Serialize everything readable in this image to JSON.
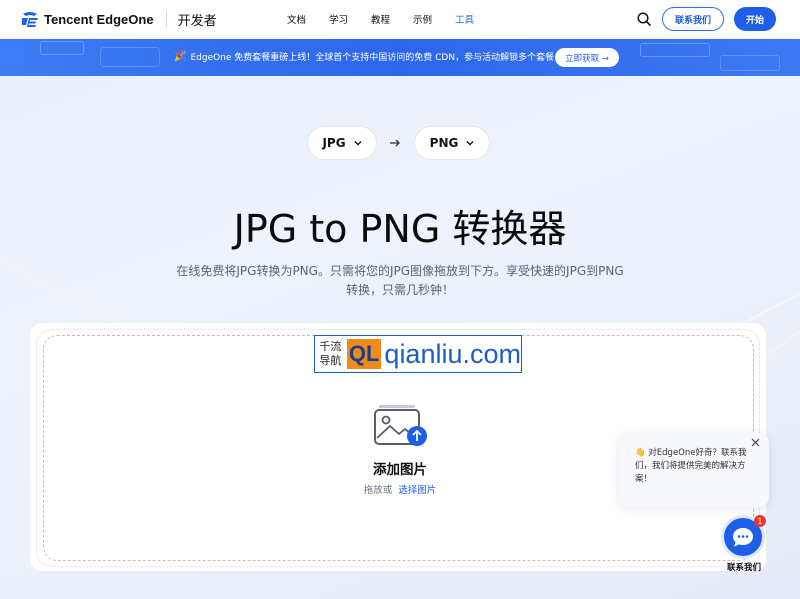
{
  "header": {
    "brand": "Tencent EdgeOne",
    "section": "开发者",
    "nav": [
      {
        "label": "文档",
        "active": false
      },
      {
        "label": "学习",
        "active": false
      },
      {
        "label": "教程",
        "active": false
      },
      {
        "label": "示例",
        "active": false
      },
      {
        "label": "工具",
        "active": true
      }
    ],
    "contact_label": "联系我们",
    "start_label": "开始",
    "search_icon": "search-icon"
  },
  "banner": {
    "text": "EdgeOne 免费套餐重磅上线！全球首个支持中国访问的免费 CDN，参与活动解锁多个套餐！",
    "cta_label": "立即获取 →",
    "icon": "party-popper-icon"
  },
  "converter": {
    "from_format": "JPG",
    "to_format": "PNG",
    "title": "JPG to PNG 转换器",
    "description": "在线免费将JPG转换为PNG。只需将您的JPG图像拖放到下方。享受快速的JPG到PNG转换，只需几秒钟！"
  },
  "upload": {
    "title": "添加图片",
    "hint": "拖放或",
    "link": "选择图片"
  },
  "watermark": {
    "cn_top": "千流",
    "cn_bottom": "导航",
    "logo": "QL",
    "text": "qianliu.com"
  },
  "chat": {
    "message": "👋 对EdgeOne好奇？联系我们，我们将提供完美的解决方案！",
    "badge": "1",
    "label": "联系我们"
  },
  "colors": {
    "accent": "#1f5ee6",
    "banner": "#2c67ea",
    "badge": "#e8372e"
  }
}
